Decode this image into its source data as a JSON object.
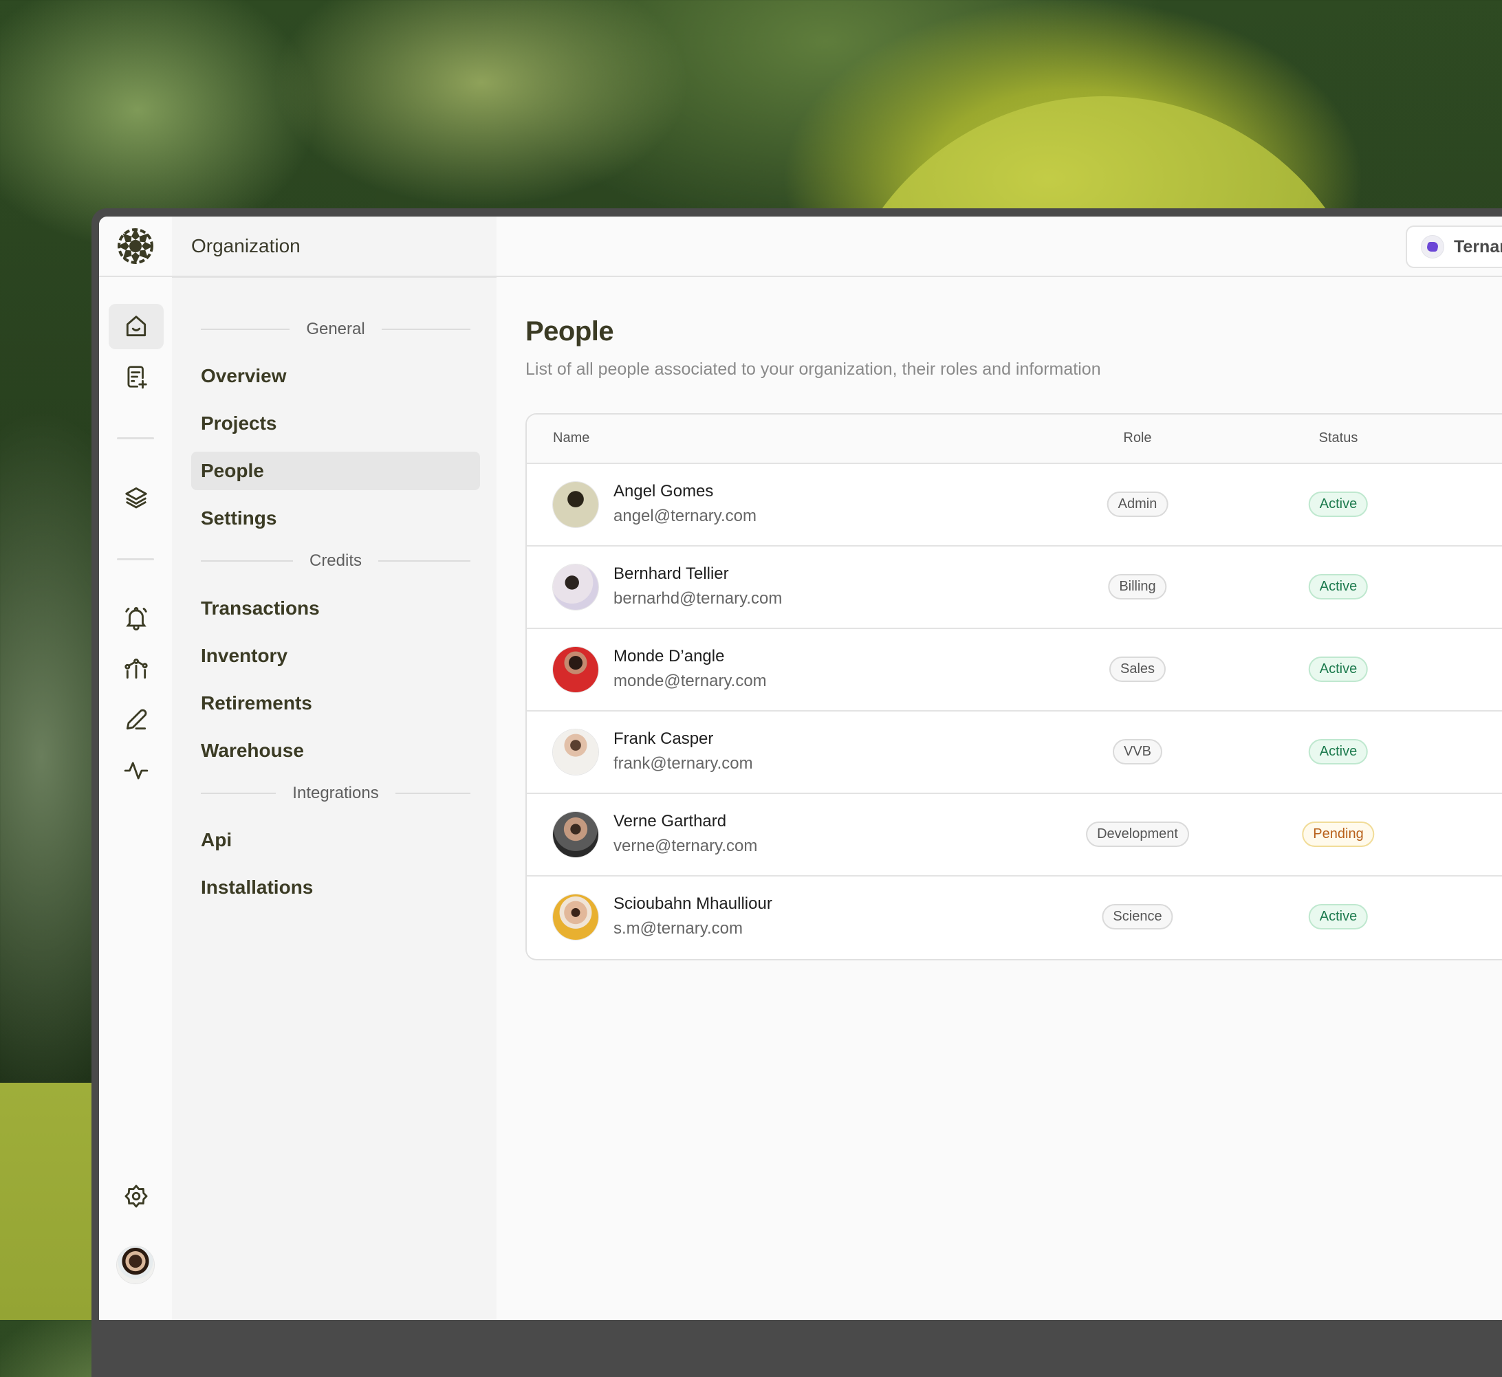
{
  "app": {
    "section_title": "Organization",
    "org_switcher": {
      "name": "Ternary",
      "icon": "ternary-logo-icon",
      "accent": "#6b46d6"
    }
  },
  "rail": {
    "logo": "asterisk-flower-logo",
    "items": [
      {
        "icon": "home-icon",
        "active": true
      },
      {
        "icon": "document-add-icon",
        "active": false
      },
      {
        "icon": "layers-icon",
        "active": false
      },
      {
        "icon": "bell-icon",
        "active": false
      },
      {
        "icon": "chart-nodes-icon",
        "active": false
      },
      {
        "icon": "pen-icon",
        "active": false
      },
      {
        "icon": "activity-icon",
        "active": false
      },
      {
        "icon": "gear-icon",
        "active": false
      }
    ],
    "avatar": "user-avatar"
  },
  "sidebar": {
    "sections": [
      {
        "label": "General",
        "items": [
          "Overview",
          "Projects",
          "People",
          "Settings"
        ]
      },
      {
        "label": "Credits",
        "items": [
          "Transactions",
          "Inventory",
          "Retirements",
          "Warehouse"
        ]
      },
      {
        "label": "Integrations",
        "items": [
          "Api",
          "Installations"
        ]
      }
    ],
    "active_item": "People"
  },
  "page": {
    "title": "People",
    "subtitle": "List of all people associated to your organization, their roles and information"
  },
  "table": {
    "columns": {
      "name": "Name",
      "role": "Role",
      "status": "Status"
    },
    "rows": [
      {
        "name": "Angel Gomes",
        "email": "angel@ternary.com",
        "role": "Admin",
        "status": "Active"
      },
      {
        "name": "Bernhard Tellier",
        "email": "bernarhd@ternary.com",
        "role": "Billing",
        "status": "Active"
      },
      {
        "name": "Monde D’angle",
        "email": "monde@ternary.com",
        "role": "Sales",
        "status": "Active"
      },
      {
        "name": "Frank Casper",
        "email": "frank@ternary.com",
        "role": "VVB",
        "status": "Active"
      },
      {
        "name": "Verne Garthard",
        "email": "verne@ternary.com",
        "role": "Development",
        "status": "Pending"
      },
      {
        "name": "Scioubahn Mhaulliour",
        "email": "s.m@ternary.com",
        "role": "Science",
        "status": "Active"
      }
    ]
  },
  "colors": {
    "primary_text": "#3b3b24",
    "active_status": "#1c7a4d",
    "pending_status": "#b8601a"
  }
}
